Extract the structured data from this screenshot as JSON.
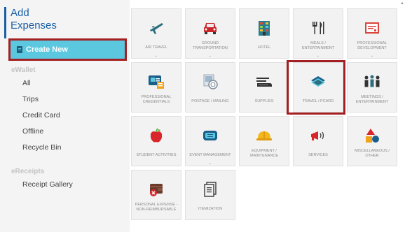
{
  "sidebar": {
    "title_line1": "Add",
    "title_line2": "Expenses",
    "create_new": "Create New",
    "ewallet_label": "eWallet",
    "ewallet_items": [
      "All",
      "Trips",
      "Credit Card",
      "Offline",
      "Recycle Bin"
    ],
    "ereceipts_label": "eReceipts",
    "ereceipts_items": [
      "Receipt Gallery"
    ]
  },
  "tiles": [
    {
      "line1": "AIR TRAVEL",
      "line2": "",
      "dropdown": true,
      "icon": "airplane-icon"
    },
    {
      "line1": "GROUND",
      "line2": "TRANSPORTATION",
      "dropdown": true,
      "icon": "car-icon"
    },
    {
      "line1": "HOTEL",
      "line2": "",
      "dropdown": false,
      "icon": "hotel-icon"
    },
    {
      "line1": "MEALS /",
      "line2": "ENTERTAINMENT",
      "dropdown": true,
      "icon": "fork-knife-icon"
    },
    {
      "line1": "PROFESSIONAL",
      "line2": "DEVELOPMENT",
      "dropdown": true,
      "icon": "certificate-icon"
    },
    {
      "line1": "PROFESSIONAL",
      "line2": "CREDENTIALS",
      "dropdown": false,
      "icon": "credentials-icon"
    },
    {
      "line1": "POSTAGE / MAILING",
      "line2": "",
      "dropdown": false,
      "icon": "postage-icon"
    },
    {
      "line1": "SUPPLIES",
      "line2": "",
      "dropdown": false,
      "icon": "supplies-icon"
    },
    {
      "line1": "TRAVEL / PCARD",
      "line2": "",
      "dropdown": false,
      "icon": "credit-card-icon"
    },
    {
      "line1": "MEETINGS /",
      "line2": "ENTERTAINMENT",
      "dropdown": false,
      "icon": "people-icon"
    },
    {
      "line1": "STUDENT ACTIVITIES",
      "line2": "",
      "dropdown": false,
      "icon": "apple-icon"
    },
    {
      "line1": "EVENT MANAGEMENT",
      "line2": "",
      "dropdown": true,
      "icon": "ticket-icon"
    },
    {
      "line1": "EQUIPMENT /",
      "line2": "MAINTENANCE",
      "dropdown": false,
      "icon": "hardhat-icon"
    },
    {
      "line1": "SERVICES",
      "line2": "",
      "dropdown": false,
      "icon": "megaphone-icon"
    },
    {
      "line1": "MISCELLANEOUS /",
      "line2": "OTHER",
      "dropdown": false,
      "icon": "shapes-icon"
    },
    {
      "line1": "PERSONAL EXPENSE -",
      "line2": "NON-REIMBURSABLE",
      "dropdown": false,
      "icon": "wallet-x-icon"
    },
    {
      "line1": "ITEMIZATION",
      "line2": "",
      "dropdown": false,
      "icon": "itemization-icon"
    }
  ],
  "chevron": "⌄",
  "colors": {
    "accent_blue": "#1a5fa6",
    "create_btn": "#5bc8df",
    "highlight_red": "#a41f21"
  }
}
